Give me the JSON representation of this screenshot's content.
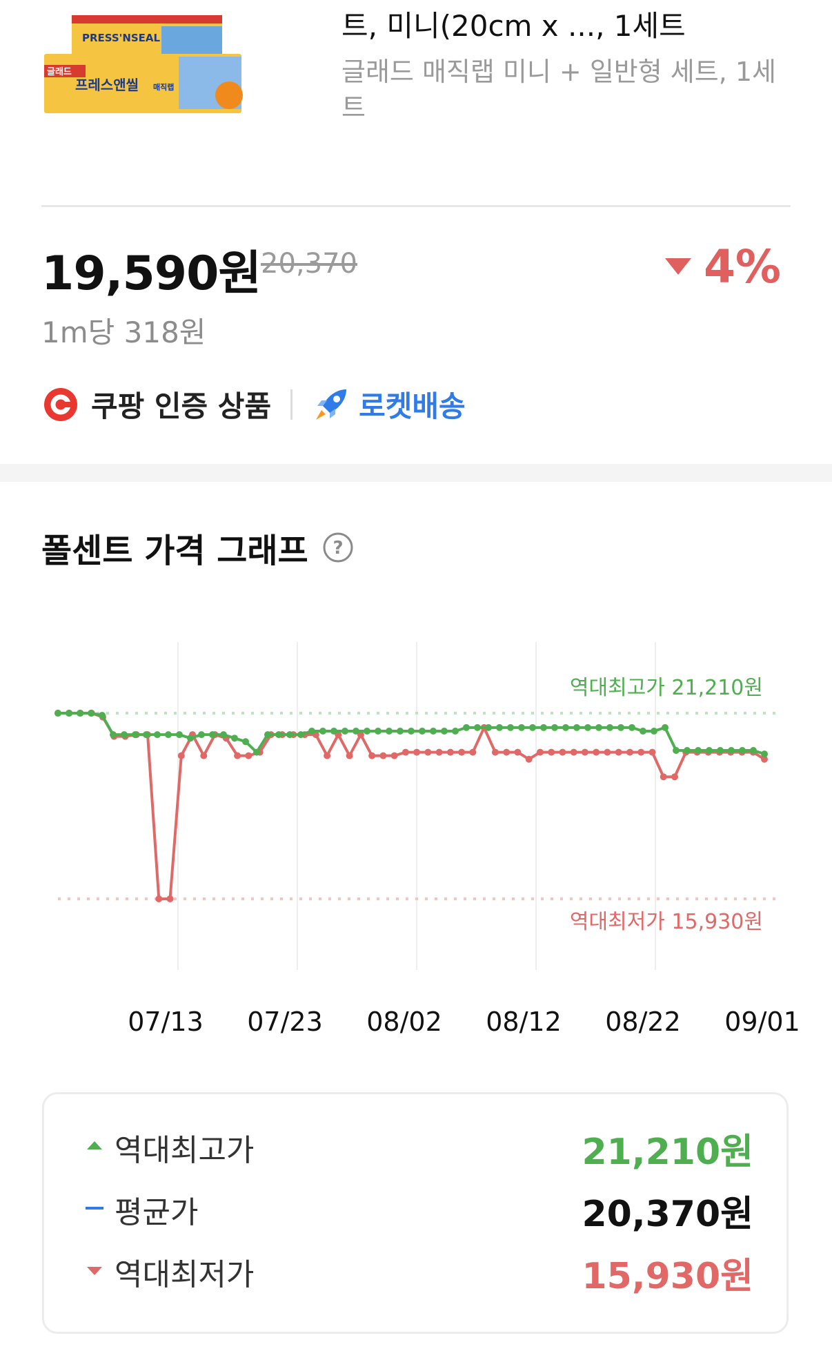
{
  "product": {
    "title": "트, 미니(20cm x ..., 1세트",
    "subtitle": "글래드 매직랩 미니 + 일반형 세트, 1세트",
    "image_texts": {
      "brand": "PRESS'NSEAL",
      "kr_brand": "글래드",
      "kr_name": "프레스앤씰",
      "kr_sub": "매직랩"
    }
  },
  "price": {
    "current": "19,590원",
    "original": "20,370",
    "discount": "4%",
    "unit_price": "1m당 318원"
  },
  "badges": {
    "certified": "쿠팡 인증 상품",
    "rocket": "로켓배송"
  },
  "graph": {
    "title": "폴센트 가격 그래프",
    "max_label": "역대최고가 21,210원",
    "min_label": "역대최저가 15,930원"
  },
  "summary": {
    "high_label": "역대최고가",
    "high_value": "21,210원",
    "avg_label": "평균가",
    "avg_value": "20,370원",
    "low_label": "역대최저가",
    "low_value": "15,930원"
  },
  "colors": {
    "green": "#4fae4f",
    "red": "#e06866",
    "blue": "#2f7be8"
  },
  "chart_data": {
    "type": "line",
    "x_ticks": [
      "07/13",
      "07/23",
      "08/02",
      "08/12",
      "08/22",
      "09/01"
    ],
    "ylim": [
      15930,
      21210
    ],
    "series": [
      {
        "color": "#4fae4f",
        "values": [
          21210,
          21210,
          21210,
          21210,
          21150,
          20600,
          20600,
          20600,
          20600,
          20600,
          20600,
          20600,
          20500,
          20600,
          20600,
          20600,
          20500,
          20400,
          20100,
          20600,
          20600,
          20600,
          20600,
          20700,
          20700,
          20700,
          20700,
          20700,
          20700,
          20700,
          20700,
          20700,
          20700,
          20700,
          20700,
          20700,
          20700,
          20800,
          20800,
          20800,
          20800,
          20800,
          20800,
          20800,
          20800,
          20800,
          20800,
          20800,
          20800,
          20800,
          20800,
          20800,
          20800,
          20700,
          20700,
          20800,
          20150,
          20150,
          20150,
          20150,
          20150,
          20150,
          20150,
          20150,
          20050
        ]
      },
      {
        "color": "#e06866",
        "values": [
          21210,
          21210,
          21210,
          21210,
          21100,
          20550,
          20550,
          20600,
          20600,
          15930,
          15930,
          20000,
          20600,
          20000,
          20600,
          20500,
          20000,
          20000,
          20100,
          20600,
          20600,
          20600,
          20600,
          20600,
          20000,
          20600,
          20000,
          20600,
          20000,
          20000,
          20000,
          20100,
          20100,
          20100,
          20100,
          20100,
          20100,
          20100,
          20800,
          20100,
          20100,
          20100,
          19900,
          20100,
          20100,
          20100,
          20100,
          20100,
          20100,
          20100,
          20100,
          20100,
          20100,
          20100,
          19400,
          19400,
          20100,
          20100,
          20100,
          20100,
          20100,
          20100,
          20100,
          19900
        ]
      }
    ]
  }
}
